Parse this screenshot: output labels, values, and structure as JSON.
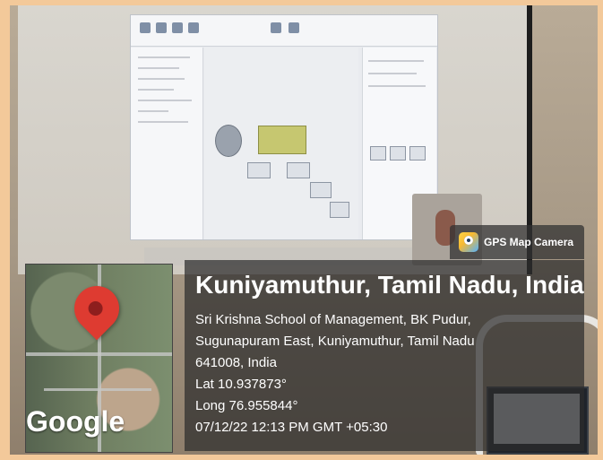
{
  "badge": {
    "app_name": "GPS Map Camera"
  },
  "location": {
    "title": "Kuniyamuthur, Tamil Nadu, India",
    "lines": [
      "Sri Krishna School of Management, BK Pudur,",
      "Sugunapuram East, Kuniyamuthur, Tamil Nadu",
      "641008, India",
      "Lat 10.937873°",
      "Long 76.955844°",
      "07/12/22 12:13 PM GMT +05:30"
    ]
  },
  "map": {
    "brand": "Google"
  }
}
